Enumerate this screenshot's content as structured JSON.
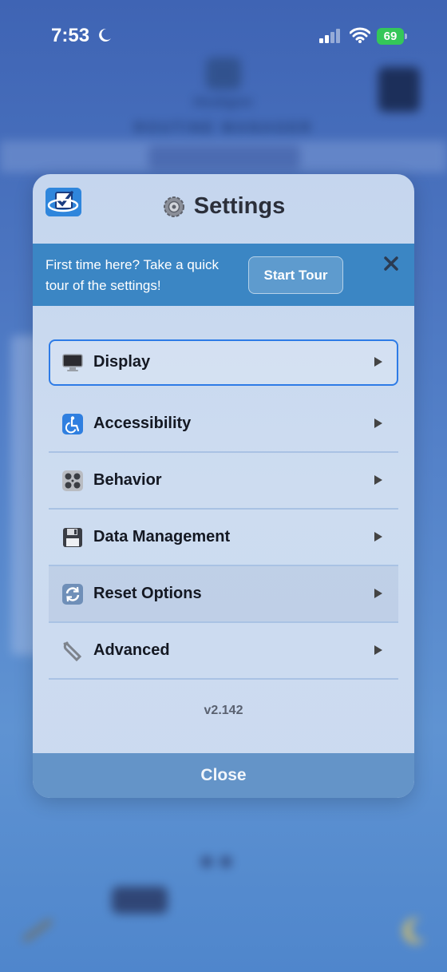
{
  "status_bar": {
    "time": "7:53",
    "battery": "69"
  },
  "background_app": {
    "brand": "Hoskgrer",
    "subtitle": "ROUTINE MANAGER"
  },
  "settings_modal": {
    "title": "Settings",
    "tour_banner": {
      "text": "First time here? Take a quick tour of the settings!",
      "button_label": "Start Tour"
    },
    "menu_items": [
      {
        "label": "Display",
        "icon": "monitor-icon"
      },
      {
        "label": "Accessibility",
        "icon": "wheelchair-icon"
      },
      {
        "label": "Behavior",
        "icon": "controls-icon"
      },
      {
        "label": "Data Management",
        "icon": "floppy-disk-icon"
      },
      {
        "label": "Reset Options",
        "icon": "refresh-icon"
      },
      {
        "label": "Advanced",
        "icon": "wrench-icon"
      }
    ],
    "version": "v2.142",
    "close_label": "Close"
  },
  "colors": {
    "accent": "#2d7be6",
    "banner": "#3b86c4",
    "close_bar": "#6494c8",
    "battery": "#34c759"
  }
}
